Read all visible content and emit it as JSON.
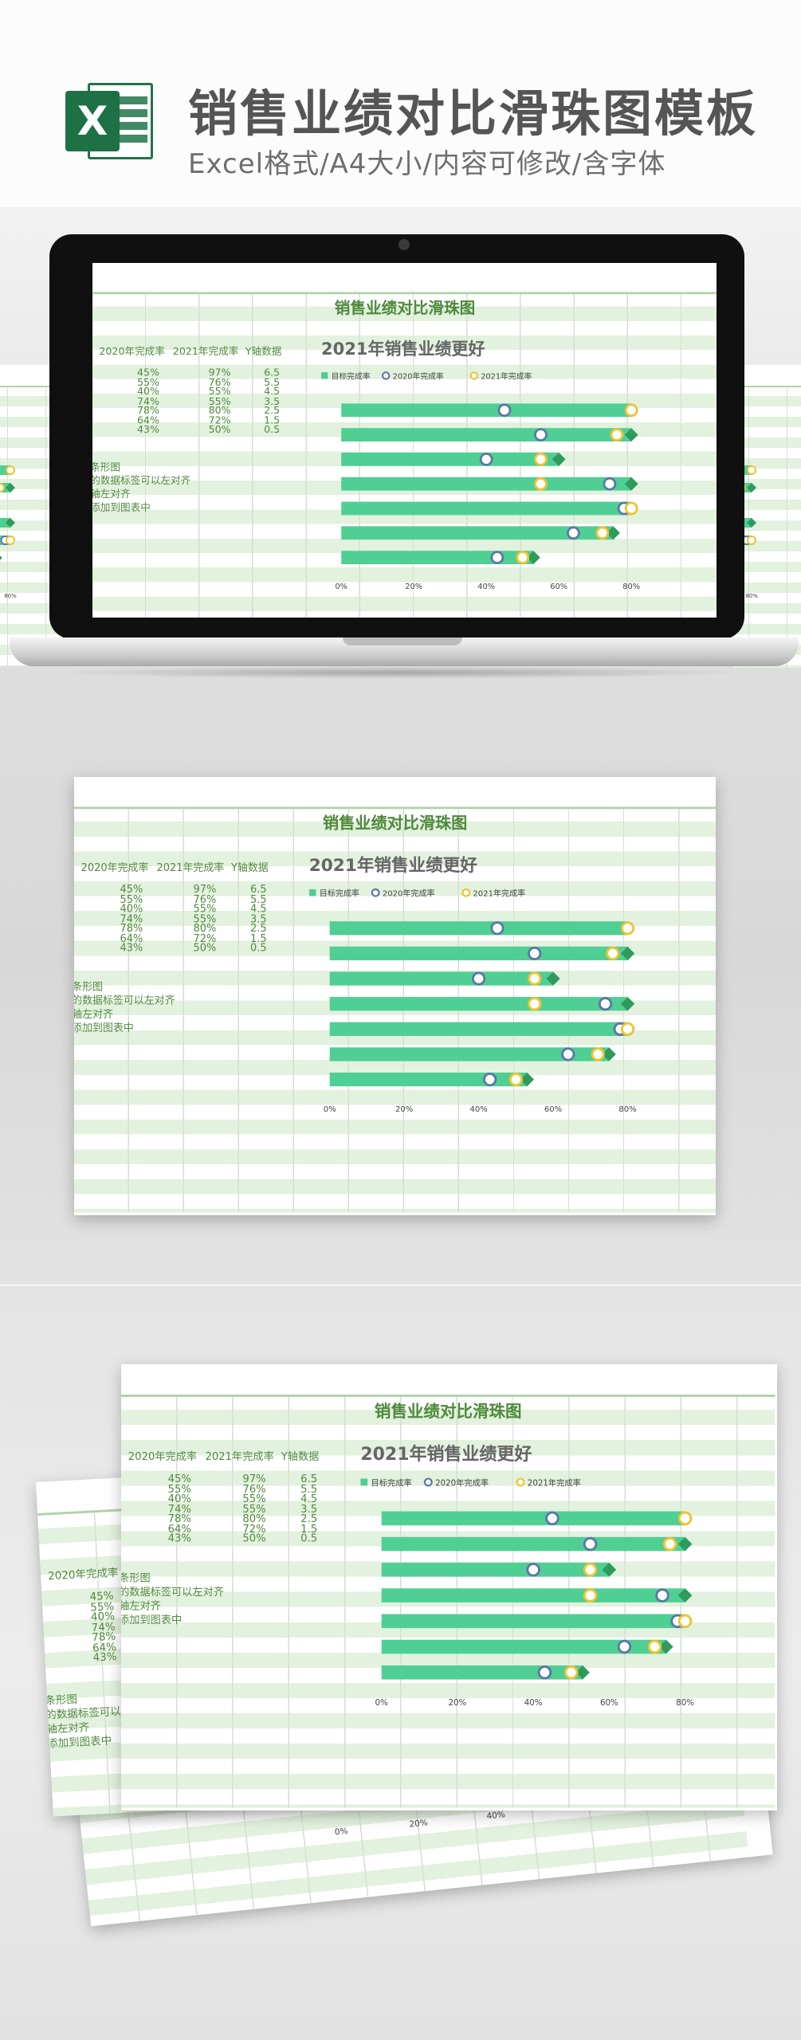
{
  "header": {
    "logo_letter": "X",
    "title": "销售业绩对比滑珠图模板",
    "subtitle": "Excel格式/A4大小/内容可修改/含字体"
  },
  "sheet": {
    "title": "销售业绩对比滑珠图",
    "columns": [
      "2020年完成率",
      "2021年完成率",
      "Y轴数据"
    ],
    "rows": [
      {
        "c2020": "45%",
        "c2021": "97%",
        "y": "6.5"
      },
      {
        "c2020": "55%",
        "c2021": "76%",
        "y": "5.5"
      },
      {
        "c2020": "40%",
        "c2021": "55%",
        "y": "4.5"
      },
      {
        "c2020": "74%",
        "c2021": "55%",
        "y": "3.5"
      },
      {
        "c2020": "78%",
        "c2021": "80%",
        "y": "2.5"
      },
      {
        "c2020": "64%",
        "c2021": "72%",
        "y": "1.5"
      },
      {
        "c2020": "43%",
        "c2021": "50%",
        "y": "0.5"
      }
    ],
    "notes": [
      "条形图",
      "的数据标签可以左对齐",
      "轴左对齐",
      "添加到图表中"
    ],
    "notes_alt": [
      "条形图",
      "的数据标签可以左对齐",
      "轴左对齐",
      "添加到图表中"
    ]
  },
  "colors": {
    "bar": "#4fcf93",
    "c2020": "#5a78a8",
    "c2021": "#f0c330",
    "target": "#2e9a5c",
    "text": "#4f8a3c"
  },
  "chart_data": {
    "type": "bar",
    "title": "2021年销售业绩更好",
    "legend": [
      "目标完成率",
      "2020年完成率",
      "2021年完成率"
    ],
    "x_ticks": [
      "0%",
      "20%",
      "40%",
      "60%",
      "80%"
    ],
    "xlim": [
      0,
      0.8
    ],
    "series": [
      {
        "name": "2020年完成率",
        "values": [
          0.45,
          0.55,
          0.4,
          0.74,
          0.78,
          0.64,
          0.43
        ]
      },
      {
        "name": "2021年完成率",
        "values": [
          0.97,
          0.76,
          0.55,
          0.55,
          0.8,
          0.72,
          0.5
        ]
      },
      {
        "name": "目标完成率",
        "values": [
          0.8,
          0.8,
          0.6,
          0.8,
          0.8,
          0.75,
          0.53
        ]
      }
    ],
    "y": [
      6.5,
      5.5,
      4.5,
      3.5,
      2.5,
      1.5,
      0.5
    ]
  }
}
